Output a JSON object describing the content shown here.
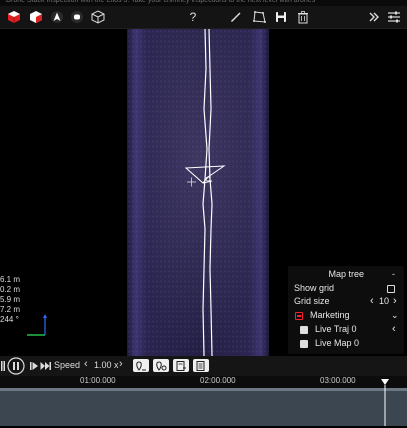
{
  "window": {
    "title": "Drone Stack Inspection with the Elios 3: Take your chimney inspections to the next level with drones"
  },
  "toolbar": {
    "help_label": "?",
    "icons": [
      "cube-red-icon",
      "cube-red-white-icon",
      "navigation-arrow-icon",
      "record-icon",
      "cube-outline-icon",
      "help-icon",
      "pencil-icon",
      "polygon-icon",
      "save-icon",
      "trash-icon",
      "double-chevron-right-icon",
      "menu-sliders-icon"
    ]
  },
  "coords": {
    "line1": "6.1 m",
    "line2": "0.2 m",
    "line3": "5.9 m",
    "line4": "7.2 m",
    "line5": "244 °"
  },
  "map_tree": {
    "title": "Map tree",
    "collapse_label": "-",
    "show_grid_label": "Show grid",
    "grid_size_label": "Grid size",
    "grid_size_value": "10",
    "items": [
      {
        "label": "Marketing"
      },
      {
        "label": "Live Traj 0"
      },
      {
        "label": "Live Map 0"
      }
    ]
  },
  "playback": {
    "speed_label": "Speed",
    "speed_value": "1.00 x"
  },
  "timeline": {
    "ticks": [
      "01:00.000",
      "02:00.000",
      "03:00.000"
    ],
    "playhead_fraction": 0.945
  },
  "colors": {
    "accent_red": "#e02020",
    "chimney_purple": "#3d3570",
    "timeline_track": "#3c4650"
  }
}
